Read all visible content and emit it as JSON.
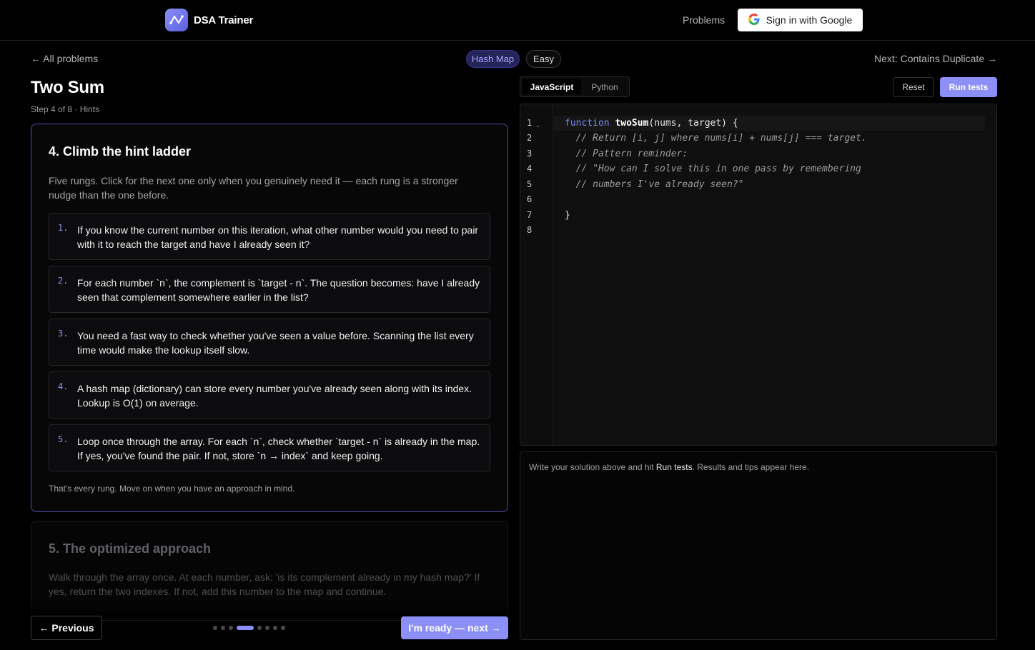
{
  "header": {
    "brand": "DSA Trainer",
    "nav_problems": "Problems",
    "sign_in": "Sign in with Google"
  },
  "problem": {
    "back_link": "← All problems",
    "tag": "Hash Map",
    "difficulty": "Easy",
    "next_link": "Next: Contains Duplicate →",
    "title": "Two Sum",
    "subtitle": "Step 4 of 8 · Hints"
  },
  "steps": {
    "current": {
      "heading": "4. Climb the hint ladder",
      "description": "Five rungs. Click for the next one only when you genuinely need it — each rung is a stronger nudge than the one before.",
      "hints": [
        {
          "num": "1.",
          "text": "If you know the current number on this iteration, what other number would you need to pair with it to reach the target and have I already seen it?"
        },
        {
          "num": "2.",
          "text": "For each number `n`, the complement is `target - n`. The question becomes: have I already seen that complement somewhere earlier in the list?"
        },
        {
          "num": "3.",
          "text": "You need a fast way to check whether you've seen a value before. Scanning the list every time would make the lookup itself slow."
        },
        {
          "num": "4.",
          "text": "A hash map (dictionary) can store every number you've already seen along with its index. Lookup is O(1) on average."
        },
        {
          "num": "5.",
          "text": "Loop once through the array. For each `n`, check whether `target - n` is already in the map. If yes, you've found the pair. If not, store `n → index` and keep going."
        }
      ],
      "footer": "That's every rung. Move on when you have an approach in mind."
    },
    "next": {
      "heading": "5. The optimized approach",
      "description": "Walk through the array once. At each number, ask: 'is its complement already in my hash map?' If yes, return the two indexes. If not, add this number to the map and continue."
    },
    "progress": {
      "total": 8,
      "current": 4
    }
  },
  "navigation": {
    "previous": "← Previous",
    "ready_next": "I'm ready — next →"
  },
  "editor": {
    "tabs": [
      "JavaScript",
      "Python"
    ],
    "active_tab": "JavaScript",
    "reset": "Reset",
    "run": "Run tests",
    "line_numbers": [
      "1",
      "2",
      "3",
      "4",
      "5",
      "6",
      "7",
      "8"
    ],
    "code": {
      "keyword": "function",
      "fn_name": "twoSum",
      "params": "(nums, target) {",
      "comments": [
        "  // Return [i, j] where nums[i] + nums[j] === target.",
        "  // Pattern reminder:",
        "  // \"How can I solve this in one pass by remembering",
        "  // numbers I've already seen?\""
      ],
      "closing": "}"
    }
  },
  "output": {
    "pre": "Write your solution above and hit ",
    "emph": "Run tests",
    "post": ". Results and tips appear here."
  },
  "colors": {
    "accent": "#8b8ff6",
    "active_border": "#4d4fae",
    "tag_bg": "#25245a"
  }
}
